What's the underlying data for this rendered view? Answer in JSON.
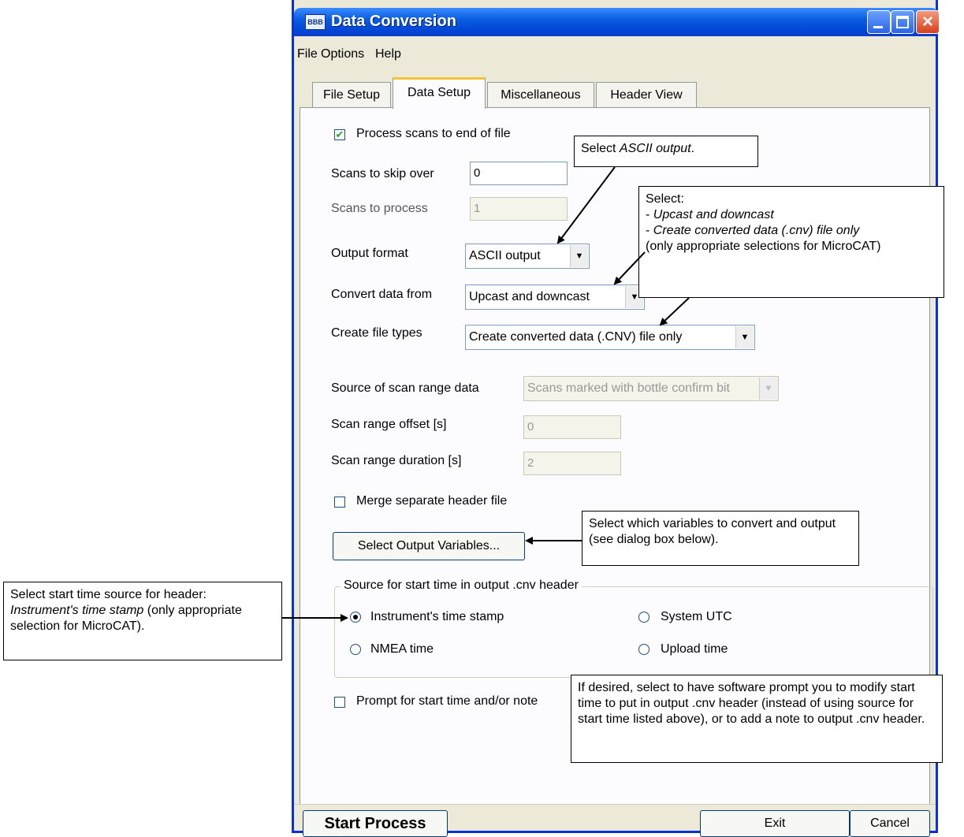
{
  "window": {
    "title": "Data Conversion",
    "app_icon_text": "BBB"
  },
  "menu": [
    "File",
    "Options",
    "Help"
  ],
  "tabs": [
    "File Setup",
    "Data Setup",
    "Miscellaneous",
    "Header View"
  ],
  "active_tab": "Data Setup",
  "form": {
    "process_scans_label": "Process scans to end of file",
    "process_scans_checked": true,
    "skip_label": "Scans to skip over",
    "skip_value": "0",
    "process_label": "Scans to process",
    "process_value": "1",
    "output_format_label": "Output format",
    "output_format_value": "ASCII output",
    "convert_from_label": "Convert data from",
    "convert_from_value": "Upcast and downcast",
    "file_types_label": "Create file types",
    "file_types_value": "Create converted data (.CNV) file only",
    "source_scan_label": "Source of scan range data",
    "source_scan_value": "Scans marked with bottle confirm bit",
    "offset_label": "Scan range offset [s]",
    "offset_value": "0",
    "duration_label": "Scan range duration [s]",
    "duration_value": "2",
    "merge_label": "Merge separate header file",
    "merge_checked": false,
    "select_vars_button": "Select Output Variables...",
    "start_time_group": "Source for start time in output .cnv header",
    "radios": [
      {
        "label": "Instrument's time stamp",
        "checked": true
      },
      {
        "label": "System UTC",
        "checked": false
      },
      {
        "label": "NMEA time",
        "checked": false
      },
      {
        "label": "Upload time",
        "checked": false
      }
    ],
    "prompt_label": "Prompt for start time and/or note",
    "prompt_checked": false
  },
  "buttons": {
    "start": "Start Process",
    "exit": "Exit",
    "cancel": "Cancel"
  },
  "callouts": {
    "ascii_pre": "Select ",
    "ascii_em": "ASCII output",
    "ascii_post": ".",
    "cast_line1": "Select:",
    "cast_line2_pre": "- ",
    "cast_line2_em": "Upcast and downcast",
    "cast_line3_pre": "- ",
    "cast_line3_em": "Create converted data (.cnv) file only",
    "cast_line4": "(only appropriate selections for MicroCAT)",
    "vars": "Select which variables to convert and output (see dialog box below).",
    "time_pre": "Select start time source for header: ",
    "time_em": "Instrument's time stamp",
    "time_post": " (only appropriate selection for MicroCAT).",
    "prompt": "If desired, select to have software prompt you to modify start time to put in output .cnv header (instead of using source for start time listed above), or to add a note to output .cnv header."
  }
}
